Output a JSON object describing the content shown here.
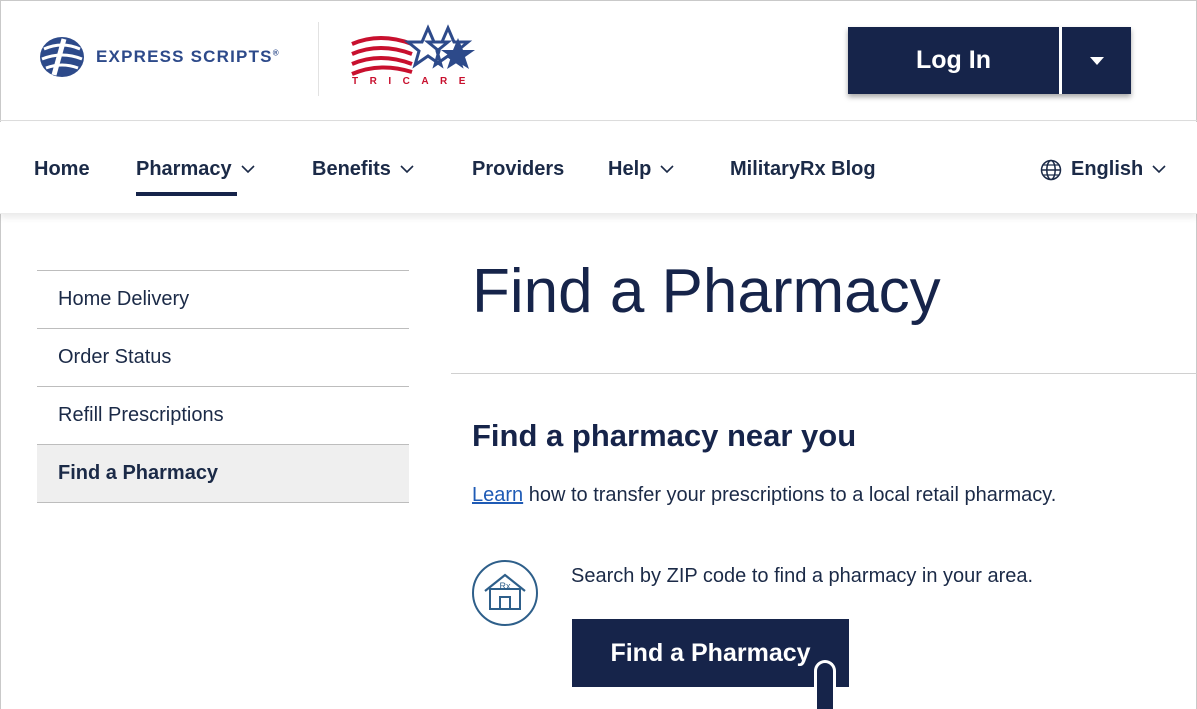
{
  "header": {
    "brand_name": "EXPRESS SCRIPTS",
    "brand_mark": "®",
    "partner_name": "TRICARE",
    "login_label": "Log In",
    "login_menu_icon": "caret-down-icon"
  },
  "nav": {
    "items": [
      {
        "label": "Home",
        "has_menu": false
      },
      {
        "label": "Pharmacy",
        "has_menu": true,
        "active": true
      },
      {
        "label": "Benefits",
        "has_menu": true
      },
      {
        "label": "Providers",
        "has_menu": false
      },
      {
        "label": "Help",
        "has_menu": true
      },
      {
        "label": "MilitaryRx Blog",
        "has_menu": false
      }
    ],
    "language": {
      "label": "English",
      "icon": "globe-icon"
    }
  },
  "sidebar": {
    "items": [
      {
        "label": "Home Delivery"
      },
      {
        "label": "Order Status"
      },
      {
        "label": "Refill Prescriptions"
      },
      {
        "label": "Find a Pharmacy",
        "active": true
      }
    ]
  },
  "main": {
    "title": "Find a Pharmacy",
    "section_title": "Find a pharmacy near you",
    "learn_link": "Learn",
    "learn_rest": " how to transfer your prescriptions to a local retail pharmacy.",
    "search_text": "Search by ZIP code to find a pharmacy in your area.",
    "rx_icon_label": "Rx",
    "find_button": "Find a Pharmacy"
  },
  "colors": {
    "navy": "#16244a",
    "link": "#1f5bb5",
    "tricare_red": "#c8102e",
    "brand_blue": "#2d4a8a"
  }
}
